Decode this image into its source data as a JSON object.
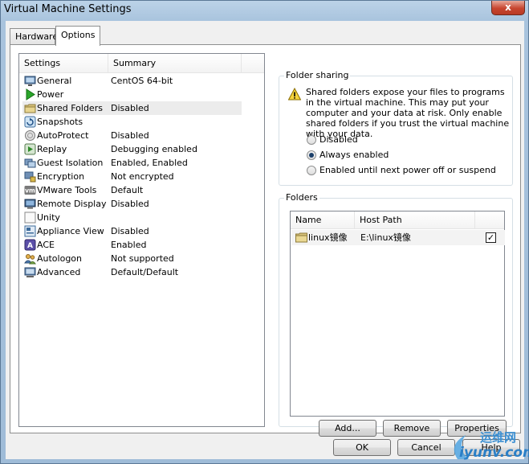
{
  "window": {
    "title": "Virtual Machine Settings",
    "close_label": "x"
  },
  "tabs": [
    {
      "label": "Hardware"
    },
    {
      "label": "Options"
    }
  ],
  "settings_list": {
    "headers": {
      "setting": "Settings",
      "summary": "Summary"
    },
    "items": [
      {
        "setting": "General",
        "summary": "CentOS 64-bit",
        "icon": "general-icon"
      },
      {
        "setting": "Power",
        "summary": "",
        "icon": "power-icon"
      },
      {
        "setting": "Shared Folders",
        "summary": "Disabled",
        "icon": "folder-icon"
      },
      {
        "setting": "Snapshots",
        "summary": "",
        "icon": "snapshot-icon"
      },
      {
        "setting": "AutoProtect",
        "summary": "Disabled",
        "icon": "autoprotect-icon"
      },
      {
        "setting": "Replay",
        "summary": "Debugging enabled",
        "icon": "replay-icon"
      },
      {
        "setting": "Guest Isolation",
        "summary": "Enabled, Enabled",
        "icon": "guest-isolation-icon"
      },
      {
        "setting": "Encryption",
        "summary": "Not encrypted",
        "icon": "lock-icon"
      },
      {
        "setting": "VMware Tools",
        "summary": "Default",
        "icon": "vm-icon"
      },
      {
        "setting": "Remote Display",
        "summary": "Disabled",
        "icon": "monitor-icon"
      },
      {
        "setting": "Unity",
        "summary": "",
        "icon": "unity-icon"
      },
      {
        "setting": "Appliance View",
        "summary": "Disabled",
        "icon": "appliance-icon"
      },
      {
        "setting": "ACE",
        "summary": "Enabled",
        "icon": "ace-icon"
      },
      {
        "setting": "Autologon",
        "summary": "Not supported",
        "icon": "users-icon"
      },
      {
        "setting": "Advanced",
        "summary": "Default/Default",
        "icon": "advanced-icon"
      }
    ],
    "selected_index": 2
  },
  "folder_sharing": {
    "label": "Folder sharing",
    "warning": "Shared folders expose your files to programs in the virtual machine. This may put your computer and your data at risk. Only enable shared folders if you trust the virtual machine with your data.",
    "options": [
      {
        "label": "Disabled",
        "checked": false
      },
      {
        "label": "Always enabled",
        "checked": true
      },
      {
        "label": "Enabled until next power off or suspend",
        "checked": false
      }
    ]
  },
  "folders": {
    "label": "Folders",
    "headers": {
      "name": "Name",
      "host_path": "Host Path",
      "enabled": ""
    },
    "rows": [
      {
        "name": "linux镜像",
        "host_path": "E:\\linux镜像",
        "checked": "✓"
      }
    ],
    "buttons": {
      "add": "Add...",
      "remove": "Remove",
      "properties": "Properties"
    }
  },
  "dialog_buttons": {
    "ok": "OK",
    "cancel": "Cancel",
    "help": "Help"
  },
  "watermark": {
    "top": "运维网",
    "bottom": "iyunv.com"
  },
  "colors": {
    "title_bar": "#a8c3dd",
    "close_button": "#c7452f",
    "selection": "#ececec",
    "radio_dot": "#1b3f6a"
  }
}
